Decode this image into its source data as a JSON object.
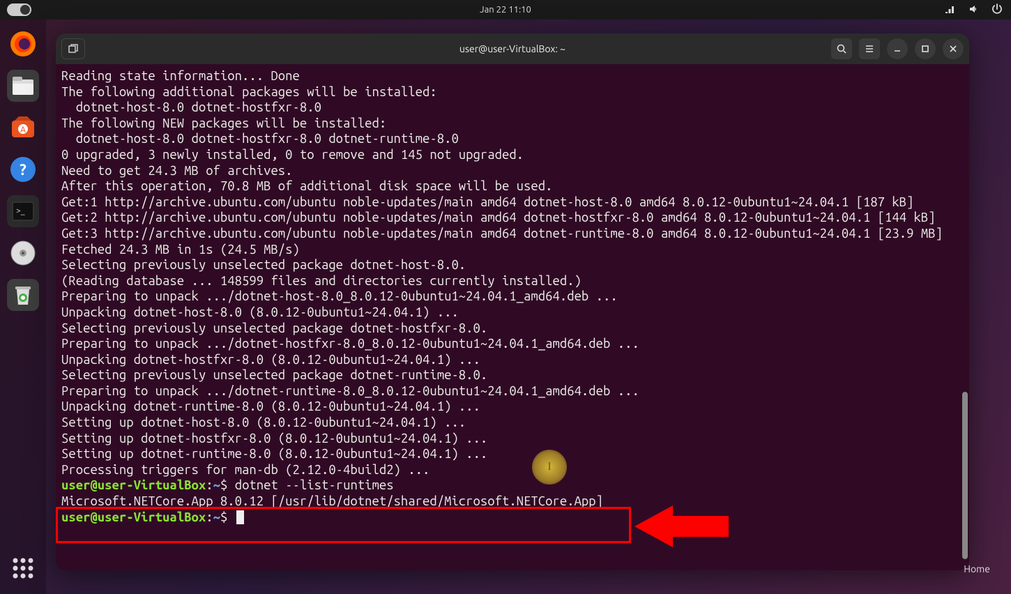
{
  "topbar": {
    "datetime": "Jan 22  11:10"
  },
  "terminal": {
    "title": "user@user-VirtualBox: ~",
    "prompt_user": "user@user-VirtualBox",
    "prompt_path": "~",
    "prompt_symbol": "$",
    "command1": "dotnet --list-runtimes",
    "output_runtime": "Microsoft.NETCore.App 8.0.12 [/usr/lib/dotnet/shared/Microsoft.NETCore.App]",
    "lines": [
      "Reading state information... Done",
      "The following additional packages will be installed:",
      "  dotnet-host-8.0 dotnet-hostfxr-8.0",
      "The following NEW packages will be installed:",
      "  dotnet-host-8.0 dotnet-hostfxr-8.0 dotnet-runtime-8.0",
      "0 upgraded, 3 newly installed, 0 to remove and 145 not upgraded.",
      "Need to get 24.3 MB of archives.",
      "After this operation, 70.8 MB of additional disk space will be used.",
      "Get:1 http://archive.ubuntu.com/ubuntu noble-updates/main amd64 dotnet-host-8.0 amd64 8.0.12-0ubuntu1~24.04.1 [187 kB]",
      "Get:2 http://archive.ubuntu.com/ubuntu noble-updates/main amd64 dotnet-hostfxr-8.0 amd64 8.0.12-0ubuntu1~24.04.1 [144 kB]",
      "Get:3 http://archive.ubuntu.com/ubuntu noble-updates/main amd64 dotnet-runtime-8.0 amd64 8.0.12-0ubuntu1~24.04.1 [23.9 MB]",
      "Fetched 24.3 MB in 1s (24.5 MB/s)",
      "Selecting previously unselected package dotnet-host-8.0.",
      "(Reading database ... 148599 files and directories currently installed.)",
      "Preparing to unpack .../dotnet-host-8.0_8.0.12-0ubuntu1~24.04.1_amd64.deb ...",
      "Unpacking dotnet-host-8.0 (8.0.12-0ubuntu1~24.04.1) ...",
      "Selecting previously unselected package dotnet-hostfxr-8.0.",
      "Preparing to unpack .../dotnet-hostfxr-8.0_8.0.12-0ubuntu1~24.04.1_amd64.deb ...",
      "Unpacking dotnet-hostfxr-8.0 (8.0.12-0ubuntu1~24.04.1) ...",
      "Selecting previously unselected package dotnet-runtime-8.0.",
      "Preparing to unpack .../dotnet-runtime-8.0_8.0.12-0ubuntu1~24.04.1_amd64.deb ...",
      "Unpacking dotnet-runtime-8.0 (8.0.12-0ubuntu1~24.04.1) ...",
      "Setting up dotnet-host-8.0 (8.0.12-0ubuntu1~24.04.1) ...",
      "Setting up dotnet-hostfxr-8.0 (8.0.12-0ubuntu1~24.04.1) ...",
      "Setting up dotnet-runtime-8.0 (8.0.12-0ubuntu1~24.04.1) ...",
      "Processing triggers for man-db (2.12.0-4build2) ..."
    ]
  },
  "desktop": {
    "home_label": "Home"
  }
}
